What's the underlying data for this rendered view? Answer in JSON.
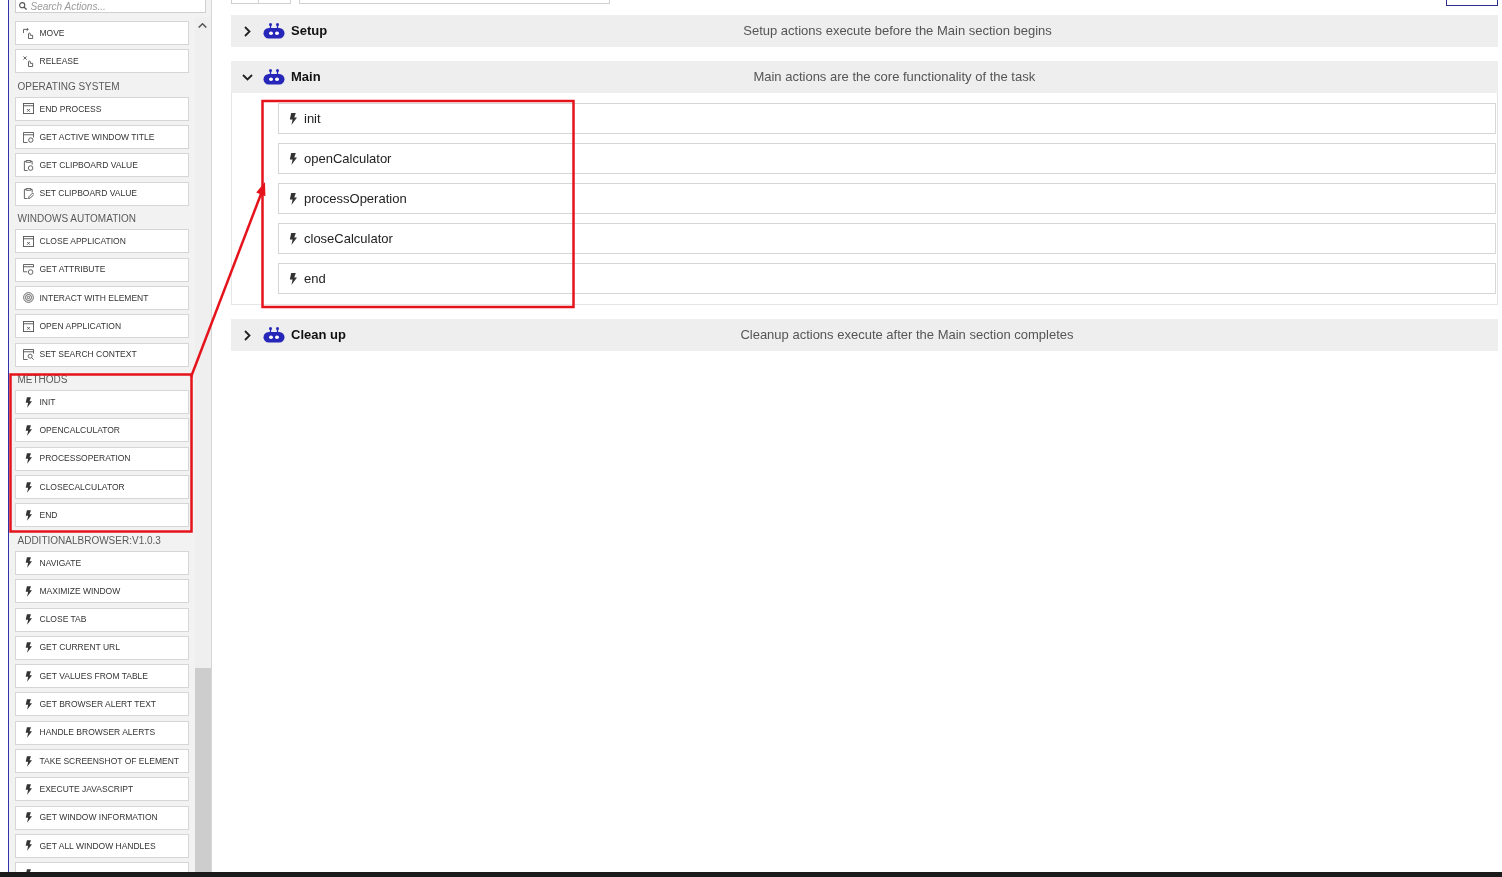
{
  "sidebar": {
    "search": {
      "placeholder": "Search Actions..."
    },
    "groups": [
      {
        "items": [
          {
            "label": "MOVE",
            "kind": "move"
          },
          {
            "label": "RELEASE",
            "kind": "release"
          }
        ]
      },
      {
        "heading": "OPERATING SYSTEM",
        "items": [
          {
            "label": "END PROCESS",
            "kind": "window-x"
          },
          {
            "label": "GET ACTIVE WINDOW TITLE",
            "kind": "window-get"
          },
          {
            "label": "GET CLIPBOARD VALUE",
            "kind": "clipboard-get"
          },
          {
            "label": "SET CLIPBOARD VALUE",
            "kind": "clipboard-set"
          }
        ]
      },
      {
        "heading": "WINDOWS AUTOMATION",
        "items": [
          {
            "label": "CLOSE APPLICATION",
            "kind": "window-x"
          },
          {
            "label": "GET ATTRIBUTE",
            "kind": "attribute"
          },
          {
            "label": "INTERACT WITH ELEMENT",
            "kind": "target"
          },
          {
            "label": "OPEN APPLICATION",
            "kind": "window-x"
          },
          {
            "label": "SET SEARCH CONTEXT",
            "kind": "window-search"
          }
        ]
      },
      {
        "heading": "METHODS",
        "items": [
          {
            "label": "INIT",
            "kind": "bolt"
          },
          {
            "label": "OPENCALCULATOR",
            "kind": "bolt"
          },
          {
            "label": "PROCESSOPERATION",
            "kind": "bolt"
          },
          {
            "label": "CLOSECALCULATOR",
            "kind": "bolt"
          },
          {
            "label": "END",
            "kind": "bolt"
          }
        ]
      },
      {
        "heading": "ADDITIONALBROWSER:V1.0.3",
        "items": [
          {
            "label": "NAVIGATE",
            "kind": "bolt"
          },
          {
            "label": "MAXIMIZE WINDOW",
            "kind": "bolt"
          },
          {
            "label": "CLOSE TAB",
            "kind": "bolt"
          },
          {
            "label": "GET CURRENT URL",
            "kind": "bolt"
          },
          {
            "label": "GET VALUES FROM TABLE",
            "kind": "bolt"
          },
          {
            "label": "GET BROWSER ALERT TEXT",
            "kind": "bolt"
          },
          {
            "label": "HANDLE BROWSER ALERTS",
            "kind": "bolt"
          },
          {
            "label": "TAKE SCREENSHOT OF ELEMENT",
            "kind": "bolt"
          },
          {
            "label": "EXECUTE JAVASCRIPT",
            "kind": "bolt"
          },
          {
            "label": "GET WINDOW INFORMATION",
            "kind": "bolt"
          },
          {
            "label": "GET ALL WINDOW HANDLES",
            "kind": "bolt"
          },
          {
            "kind": "bolt"
          }
        ]
      }
    ]
  },
  "sections": [
    {
      "title": "Setup",
      "description": "Setup actions execute before the Main section begins",
      "expanded": false
    },
    {
      "title": "Main",
      "description": "Main actions are the core functionality of the task",
      "expanded": true,
      "actions": [
        {
          "label": "init"
        },
        {
          "label": "openCalculator"
        },
        {
          "label": "processOperation"
        },
        {
          "label": "closeCalculator"
        },
        {
          "label": "end"
        }
      ]
    },
    {
      "title": "Clean up",
      "description": "Cleanup actions execute after the Main section completes",
      "expanded": false
    }
  ]
}
